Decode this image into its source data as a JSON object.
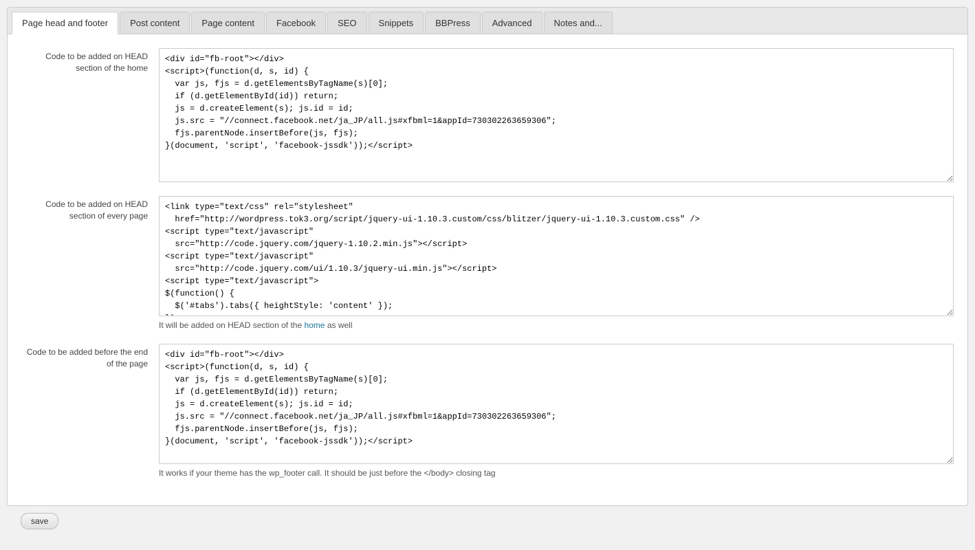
{
  "tabs": [
    {
      "id": "page-head-footer",
      "label": "Page head and footer",
      "active": true
    },
    {
      "id": "post-content",
      "label": "Post content",
      "active": false
    },
    {
      "id": "page-content",
      "label": "Page content",
      "active": false
    },
    {
      "id": "facebook",
      "label": "Facebook",
      "active": false
    },
    {
      "id": "seo",
      "label": "SEO",
      "active": false
    },
    {
      "id": "snippets",
      "label": "Snippets",
      "active": false
    },
    {
      "id": "bbpress",
      "label": "BBPress",
      "active": false
    },
    {
      "id": "advanced",
      "label": "Advanced",
      "active": false
    },
    {
      "id": "notes-and",
      "label": "Notes and...",
      "active": false
    }
  ],
  "sections": [
    {
      "id": "head-home",
      "label": "Code to be added on HEAD\nsection of the home",
      "code": "<div id=\"fb-root\"></div>\n<script>(function(d, s, id) {\n  var js, fjs = d.getElementsByTagName(s)[0];\n  if (d.getElementById(id)) return;\n  js = d.createElement(s); js.id = id;\n  js.src = \"//connect.facebook.net/ja_JP/all.js#xfbml=1&appId=730302263659306\";\n  fjs.parentNode.insertBefore(js, fjs);\n}(document, 'script', 'facebook-jssdk'));<\\/script>",
      "hint": "",
      "height": "tall"
    },
    {
      "id": "head-every-page",
      "label": "Code to be added on HEAD\nsection of every page",
      "code": "<link type=\"text/css\" rel=\"stylesheet\"\n  href=\"http://wordpress.tok3.org/script/jquery-ui-1.10.3.custom/css/blitzer/jquery-ui-1.10.3.custom.css\" />\n<script type=\"text/javascript\"\n  src=\"http://code.jquery.com/jquery-1.10.2.min.js\"><\\/script>\n<script type=\"text/javascript\"\n  src=\"http://code.jquery.com/ui/1.10.3/jquery-ui.min.js\"><\\/script>\n<script type=\"text/javascript\">\n$(function() {\n  $('#tabs').tabs({ heightStyle: 'content' });\n});\n<\\/script>",
      "hint": "It will be added on HEAD section of the home as well",
      "height": "medium"
    },
    {
      "id": "before-end-page",
      "label": "Code to be added before the end\nof the page",
      "code": "<div id=\"fb-root\"></div>\n<script>(function(d, s, id) {\n  var js, fjs = d.getElementsByTagName(s)[0];\n  if (d.getElementById(id)) return;\n  js = d.createElement(s); js.id = id;\n  js.src = \"//connect.facebook.net/ja_JP/all.js#xfbml=1&appId=730302263659306\";\n  fjs.parentNode.insertBefore(js, fjs);\n}(document, 'script', 'facebook-jssdk'));<\\/script>",
      "hint": "It works if your theme has the wp_footer call. It should be just before the </body> closing tag",
      "height": "medium"
    }
  ],
  "buttons": {
    "save_label": "save"
  }
}
